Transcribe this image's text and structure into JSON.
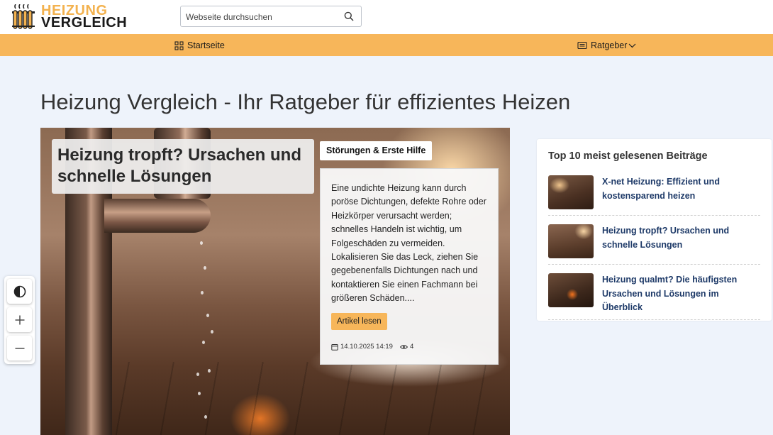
{
  "header": {
    "logo_line1": "HEIZUNG",
    "logo_line2": "VERGLEICH",
    "search_placeholder": "Webseite durchsuchen"
  },
  "nav": {
    "home_label": "Startseite",
    "ratgeber_label": "Ratgeber"
  },
  "page_title": "Heizung Vergleich - Ihr Ratgeber für effizientes Heizen",
  "featured": {
    "title": "Heizung tropft? Ursachen und schnelle Lösungen",
    "category": "Störungen & Erste Hilfe",
    "excerpt": "Eine undichte Heizung kann durch poröse Dichtungen, defekte Rohre oder Heizkörper verursacht werden; schnelles Handeln ist wichtig, um Folgeschäden zu vermeiden. Lokalisieren Sie das Leck, ziehen Sie gegebenenfalls Dichtungen nach und kontaktieren Sie einen Fachmann bei größeren Schäden....",
    "read_more": "Artikel lesen",
    "date": "14.10.2025 14:19",
    "views": "4"
  },
  "sidebar": {
    "title": "Top 10 meist gelesenen Beiträge",
    "posts": [
      {
        "title": "X-net Heizung: Effizient und kostensparend heizen"
      },
      {
        "title": "Heizung tropft? Ursachen und schnelle Lösungen"
      },
      {
        "title": "Heizung qualmt? Die häufigsten Ursachen und Lösungen im Überblick"
      }
    ]
  },
  "colors": {
    "accent": "#f7b65a",
    "link": "#1e3a68",
    "background": "#eef3fb"
  }
}
